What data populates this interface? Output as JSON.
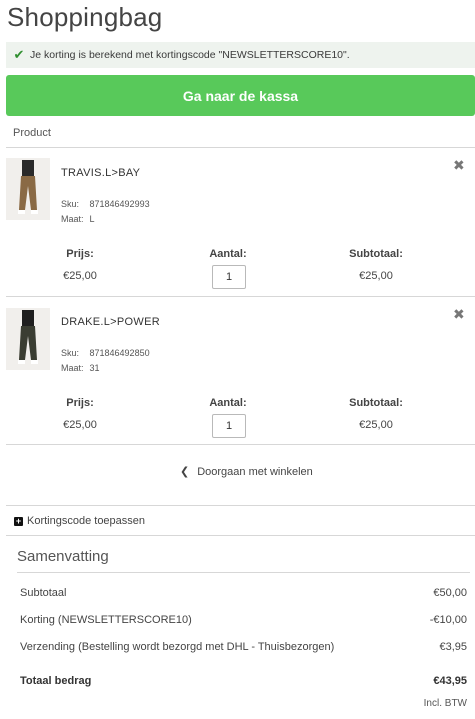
{
  "page": {
    "title": "Shoppingbag"
  },
  "notice": {
    "text": "Je korting is berekend met kortingscode \"NEWSLETTERSCORE10\"."
  },
  "checkout": {
    "label": "Ga naar de kassa",
    "color": "#58c95a"
  },
  "table": {
    "column_header": "Product"
  },
  "items": [
    {
      "name": "TRAVIS.L>BAY",
      "sku_label": "Sku:",
      "sku": "871846492993",
      "size_label": "Maat:",
      "size": "L",
      "price_label": "Prijs:",
      "price": "€25,00",
      "qty_label": "Aantal:",
      "qty": "1",
      "subtotal_label": "Subtotaal:",
      "subtotal": "€25,00",
      "image": "brown-trousers-photo"
    },
    {
      "name": "DRAKE.L>POWER",
      "sku_label": "Sku:",
      "sku": "871846492850",
      "size_label": "Maat:",
      "size": "31",
      "price_label": "Prijs:",
      "price": "€25,00",
      "qty_label": "Aantal:",
      "qty": "1",
      "subtotal_label": "Subtotaal:",
      "subtotal": "€25,00",
      "image": "dark-olive-trousers-photo"
    }
  ],
  "continue_shopping": {
    "label": "Doorgaan met winkelen"
  },
  "coupon": {
    "label": "Kortingscode toepassen"
  },
  "summary": {
    "title": "Samenvatting",
    "rows": [
      {
        "label": "Subtotaal",
        "value": "€50,00"
      },
      {
        "label": "Korting (NEWSLETTERSCORE10)",
        "value": "-€10,00"
      },
      {
        "label": "Verzending (Bestelling wordt bezorgd met DHL - Thuisbezorgen)",
        "value": "€3,95"
      }
    ],
    "total": {
      "label": "Totaal bedrag",
      "value": "€43,95"
    },
    "vat_note": "Incl. BTW"
  }
}
